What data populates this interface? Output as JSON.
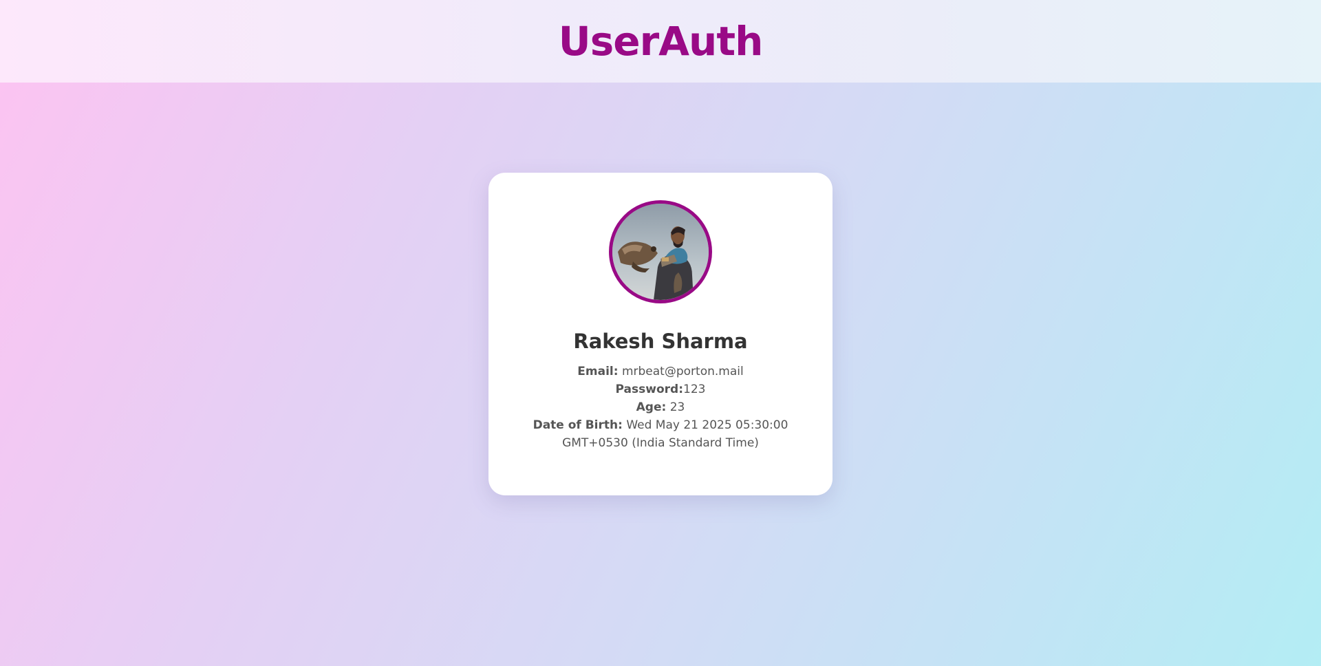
{
  "header": {
    "app_title": "UserAuth"
  },
  "profile": {
    "avatar_icon": "user-avatar-photo",
    "name": "Rakesh Sharma",
    "email_label": "Email:",
    "email_value": " mrbeat@porton.mail",
    "password_label": "Password:",
    "password_value": "123",
    "age_label": "Age:",
    "age_value": " 23",
    "dob_label": "Date of Birth:",
    "dob_value": " Wed May 21 2025 05:30:00 GMT+0530 (India Standard Time)"
  },
  "colors": {
    "accent": "#990a86",
    "text_dark": "#333333",
    "text_muted": "#555555"
  }
}
